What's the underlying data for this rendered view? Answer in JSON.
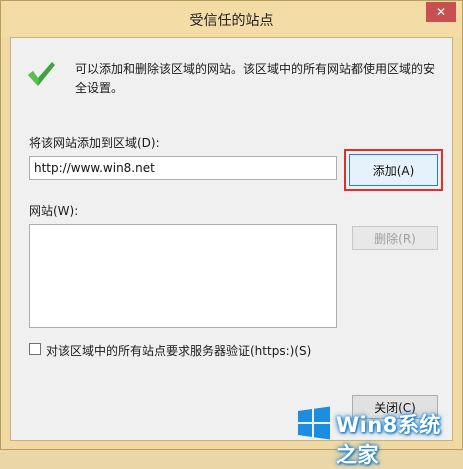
{
  "dialog": {
    "title": "受信任的站点",
    "close_icon": "close-icon",
    "description": "可以添加和删除该区域的网站。该区域中的所有网站都使用区域的安全设置。",
    "add_label": "将该网站添加到区域(D):",
    "add_input_value": "http://www.win8.net",
    "add_button": "添加(A)",
    "websites_label": "网站(W):",
    "websites": [],
    "remove_button": "删除(R)",
    "https_checkbox_label": "对该区域中的所有站点要求服务器验证(https:)(S)",
    "https_checked": false,
    "close_button": "关闭(C)"
  },
  "watermark": {
    "text": "Win8系统之家",
    "logo_icon": "windows-logo-icon"
  },
  "colors": {
    "highlight": "#e0302c",
    "check": "#3fa33f",
    "close_bg": "#c75050"
  }
}
